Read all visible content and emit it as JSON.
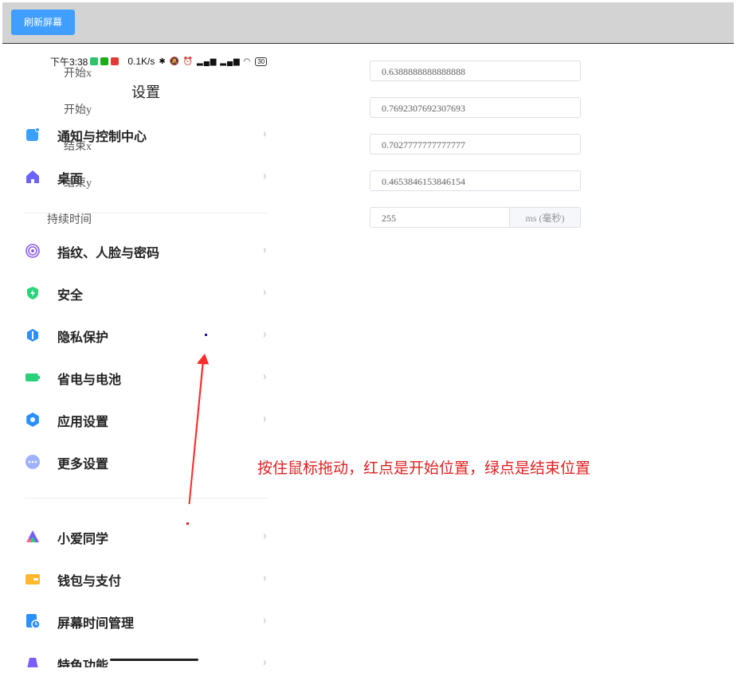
{
  "toolbar": {
    "refresh_label": "刷新屏幕"
  },
  "statusbar": {
    "time": "下午3:38",
    "speed": "0.1K/s",
    "icons": "✱ 🔕 ⏰ ▂▄▆ ▂▄▆ ◠",
    "battery": "30"
  },
  "phone": {
    "title": "设置",
    "items": [
      {
        "label": "通知与控制中心",
        "icon": "notification-icon",
        "color": "#3aa0ff"
      },
      {
        "label": "桌面",
        "icon": "home-icon",
        "color": "#6c63ff"
      },
      {
        "label": "指纹、人脸与密码",
        "icon": "fingerprint-icon",
        "color": "#8a5cf6"
      },
      {
        "label": "安全",
        "icon": "shield-icon",
        "color": "#2bd47b"
      },
      {
        "label": "隐私保护",
        "icon": "privacy-icon",
        "color": "#2b8fff"
      },
      {
        "label": "省电与电池",
        "icon": "battery-icon",
        "color": "#2ad07a"
      },
      {
        "label": "应用设置",
        "icon": "gear-icon",
        "color": "#2b8fff"
      },
      {
        "label": "更多设置",
        "icon": "more-icon",
        "color": "#9fb2ff"
      },
      {
        "label": "小爱同学",
        "icon": "xiaoai-icon",
        "color": "#7b5cff"
      },
      {
        "label": "钱包与支付",
        "icon": "wallet-icon",
        "color": "#ffb72b"
      },
      {
        "label": "屏幕时间管理",
        "icon": "screen-time-icon",
        "color": "#2b8fff"
      },
      {
        "label": "特色功能",
        "icon": "feature-icon",
        "color": "#7b5cff"
      }
    ],
    "chevron": "›"
  },
  "form": {
    "start_x": {
      "label": "开始x",
      "value": "0.6388888888888888"
    },
    "start_y": {
      "label": "开始y",
      "value": "0.7692307692307693"
    },
    "end_x": {
      "label": "结束x",
      "value": "0.7027777777777777"
    },
    "end_y": {
      "label": "结束y",
      "value": "0.4653846153846154"
    },
    "duration": {
      "label": "持续时间",
      "value": "255",
      "suffix": "ms (毫秒)"
    }
  },
  "instruction": "按住鼠标拖动，红点是开始位置，绿点是结束位置",
  "colors": {
    "accent": "#409eff",
    "instruction": "#e02020",
    "arrow": "#ff2a2a",
    "end_marker": "#1a1aa8"
  }
}
